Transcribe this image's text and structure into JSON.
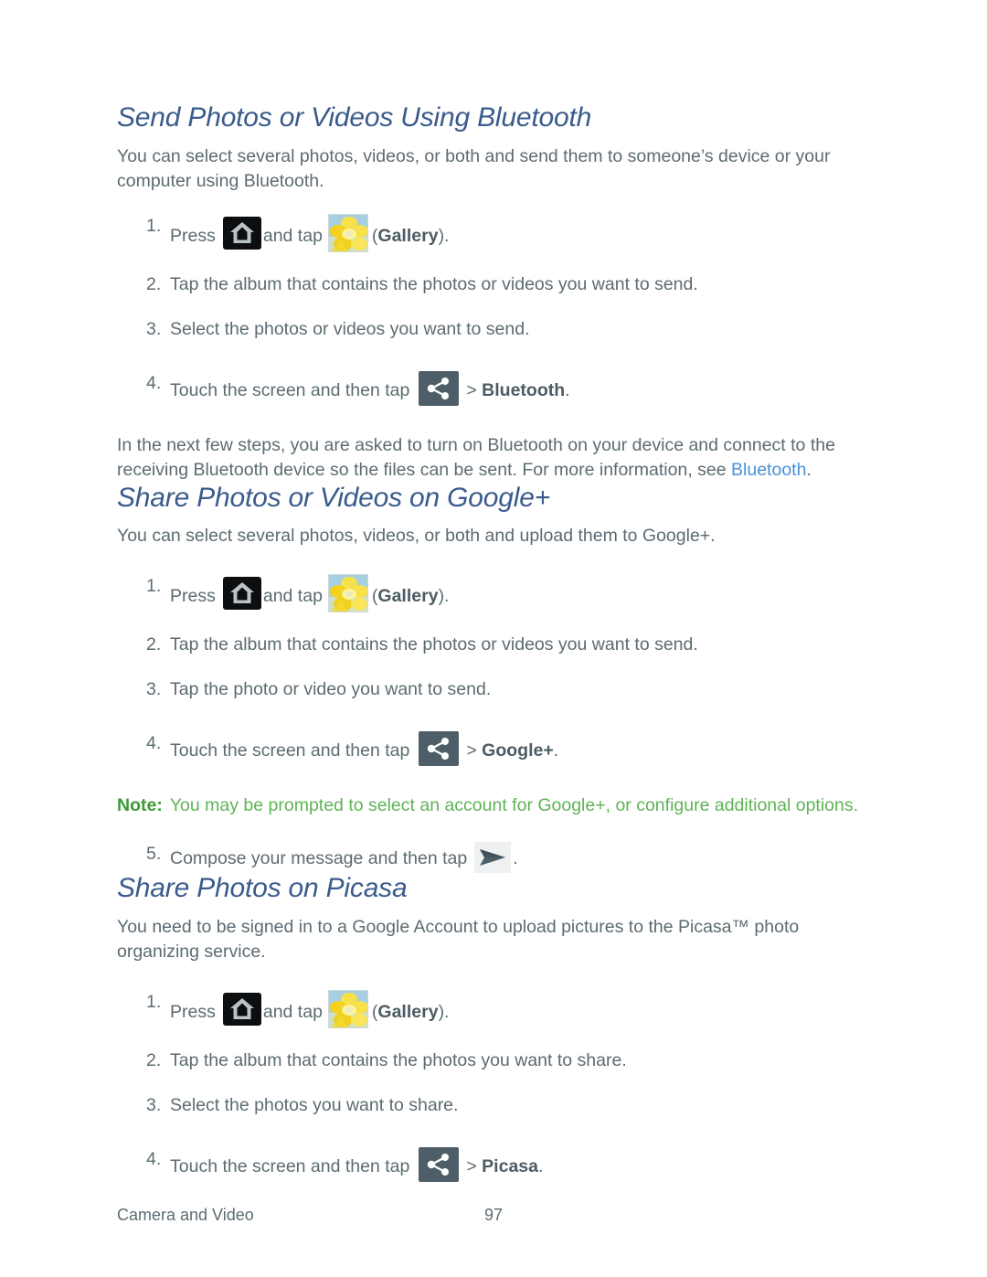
{
  "document": {
    "footer": {
      "chapter": "Camera and Video",
      "page_number": "97"
    }
  },
  "colors": {
    "heading": "#3a5b8c",
    "body_text": "#5c6b72",
    "link": "#4a90d9",
    "note": "#5fb356",
    "share_icon_bg": "#4d5e68",
    "home_icon_bg": "#0c0e10",
    "gallery_icon_accent": "#f5dc28"
  },
  "icons": {
    "home": "home-key-icon",
    "gallery": "gallery-app-icon",
    "share": "share-icon",
    "send": "send-icon"
  },
  "sections": [
    {
      "heading": "Send Photos or Videos Using Bluetooth",
      "intro": "You can select several photos, videos, or both and send them to someone’s device or your computer using Bluetooth.",
      "steps": [
        {
          "num": "1.",
          "pre": "Press",
          "mid": "and tap",
          "post": "(Gallery).",
          "post_bold": "Gallery",
          "icons": [
            "home",
            "gallery"
          ]
        },
        {
          "num": "2.",
          "text": "Tap the album that contains the photos or videos you want to send."
        },
        {
          "num": "3.",
          "text": "Select the photos or videos you want to send."
        },
        {
          "num": "4.",
          "pre": "Touch the screen and then tap",
          "post": "> Bluetooth.",
          "post_bold": "Bluetooth",
          "icons": [
            "share"
          ]
        }
      ],
      "after_text_1": "In the next few steps, you are asked to turn on Bluetooth on your device and connect to the receiving Bluetooth device so the files can be sent. For more information, see ",
      "after_link": "Bluetooth",
      "after_text_2": "."
    },
    {
      "heading": "Share Photos or Videos on Google+",
      "intro": "You can select several photos, videos, or both and upload them to Google+.",
      "steps": [
        {
          "num": "1.",
          "pre": "Press",
          "mid": "and tap",
          "post": "(Gallery).",
          "post_bold": "Gallery",
          "icons": [
            "home",
            "gallery"
          ]
        },
        {
          "num": "2.",
          "text": "Tap the album that contains the photos or videos you want to send."
        },
        {
          "num": "3.",
          "text": "Tap the photo or video you want to send."
        },
        {
          "num": "4.",
          "pre": "Touch the screen and then tap",
          "post": "> Google+.",
          "post_bold": "Google+",
          "icons": [
            "share"
          ]
        }
      ],
      "note_label": "Note:",
      "note_text": "You may be prompted to select an account for Google+, or configure additional options.",
      "steps_after_note": [
        {
          "num": "5.",
          "pre": "Compose your message and then tap",
          "post": ".",
          "icons": [
            "send"
          ]
        }
      ]
    },
    {
      "heading": "Share Photos on Picasa",
      "intro": "You need to be signed in to a Google Account to upload pictures to the Picasa™ photo organizing service.",
      "steps": [
        {
          "num": "1.",
          "pre": "Press",
          "mid": "and tap",
          "post": "(Gallery).",
          "post_bold": "Gallery",
          "icons": [
            "home",
            "gallery"
          ]
        },
        {
          "num": "2.",
          "text": "Tap the album that contains the photos you want to share."
        },
        {
          "num": "3.",
          "text": "Select the photos you want to share."
        },
        {
          "num": "4.",
          "pre": "Touch the screen and then tap",
          "post": "> Picasa.",
          "post_bold": "Picasa",
          "icons": [
            "share"
          ]
        }
      ]
    }
  ]
}
